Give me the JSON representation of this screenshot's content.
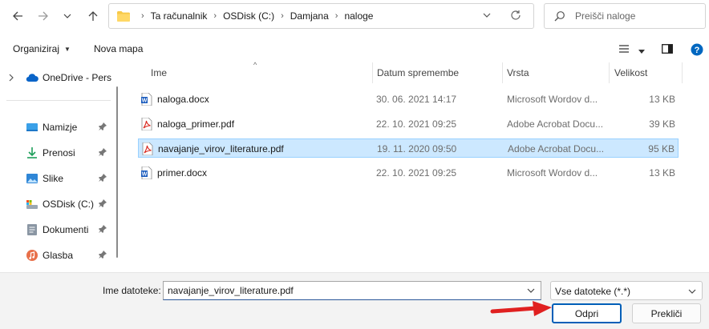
{
  "address": {
    "crumbs": [
      "Ta računalnik",
      "OSDisk (C:)",
      "Damjana",
      "naloge"
    ]
  },
  "search": {
    "placeholder": "Preišči naloge"
  },
  "toolbar": {
    "organize_label": "Organiziraj",
    "new_folder_label": "Nova mapa"
  },
  "navpane": {
    "onedrive_label": "OneDrive - Pers",
    "items": [
      {
        "label": "Namizje",
        "icon": "desktop-icon"
      },
      {
        "label": "Prenosi",
        "icon": "download-icon"
      },
      {
        "label": "Slike",
        "icon": "pictures-icon"
      },
      {
        "label": "OSDisk (C:)",
        "icon": "drive-icon"
      },
      {
        "label": "Dokumenti",
        "icon": "documents-icon"
      },
      {
        "label": "Glasba",
        "icon": "music-icon"
      }
    ]
  },
  "columns": {
    "name": "Ime",
    "date": "Datum spremembe",
    "type": "Vrsta",
    "size": "Velikost"
  },
  "files": [
    {
      "name": "naloga.docx",
      "date": "30. 06. 2021 14:17",
      "type": "Microsoft Wordov d...",
      "size": "13 KB",
      "icon": "word-doc-icon"
    },
    {
      "name": "naloga_primer.pdf",
      "date": "22. 10. 2021 09:25",
      "type": "Adobe Acrobat Docu...",
      "size": "39 KB",
      "icon": "pdf-icon"
    },
    {
      "name": "navajanje_virov_literature.pdf",
      "date": "19. 11. 2020 09:50",
      "type": "Adobe Acrobat Docu...",
      "size": "95 KB",
      "icon": "pdf-icon"
    },
    {
      "name": "primer.docx",
      "date": "22. 10. 2021 09:25",
      "type": "Microsoft Wordov d...",
      "size": "13 KB",
      "icon": "word-doc-icon"
    }
  ],
  "selected_index": 2,
  "bottom": {
    "filename_label": "Ime datoteke:",
    "filename_value": "navajanje_virov_literature.pdf",
    "filetype_value": "Vse datoteke (*.*)",
    "open_label": "Odpri",
    "cancel_label": "Prekliči"
  },
  "colors": {
    "selection_bg": "#cce8ff",
    "accent": "#005fb8",
    "arrow": "#e02020"
  }
}
